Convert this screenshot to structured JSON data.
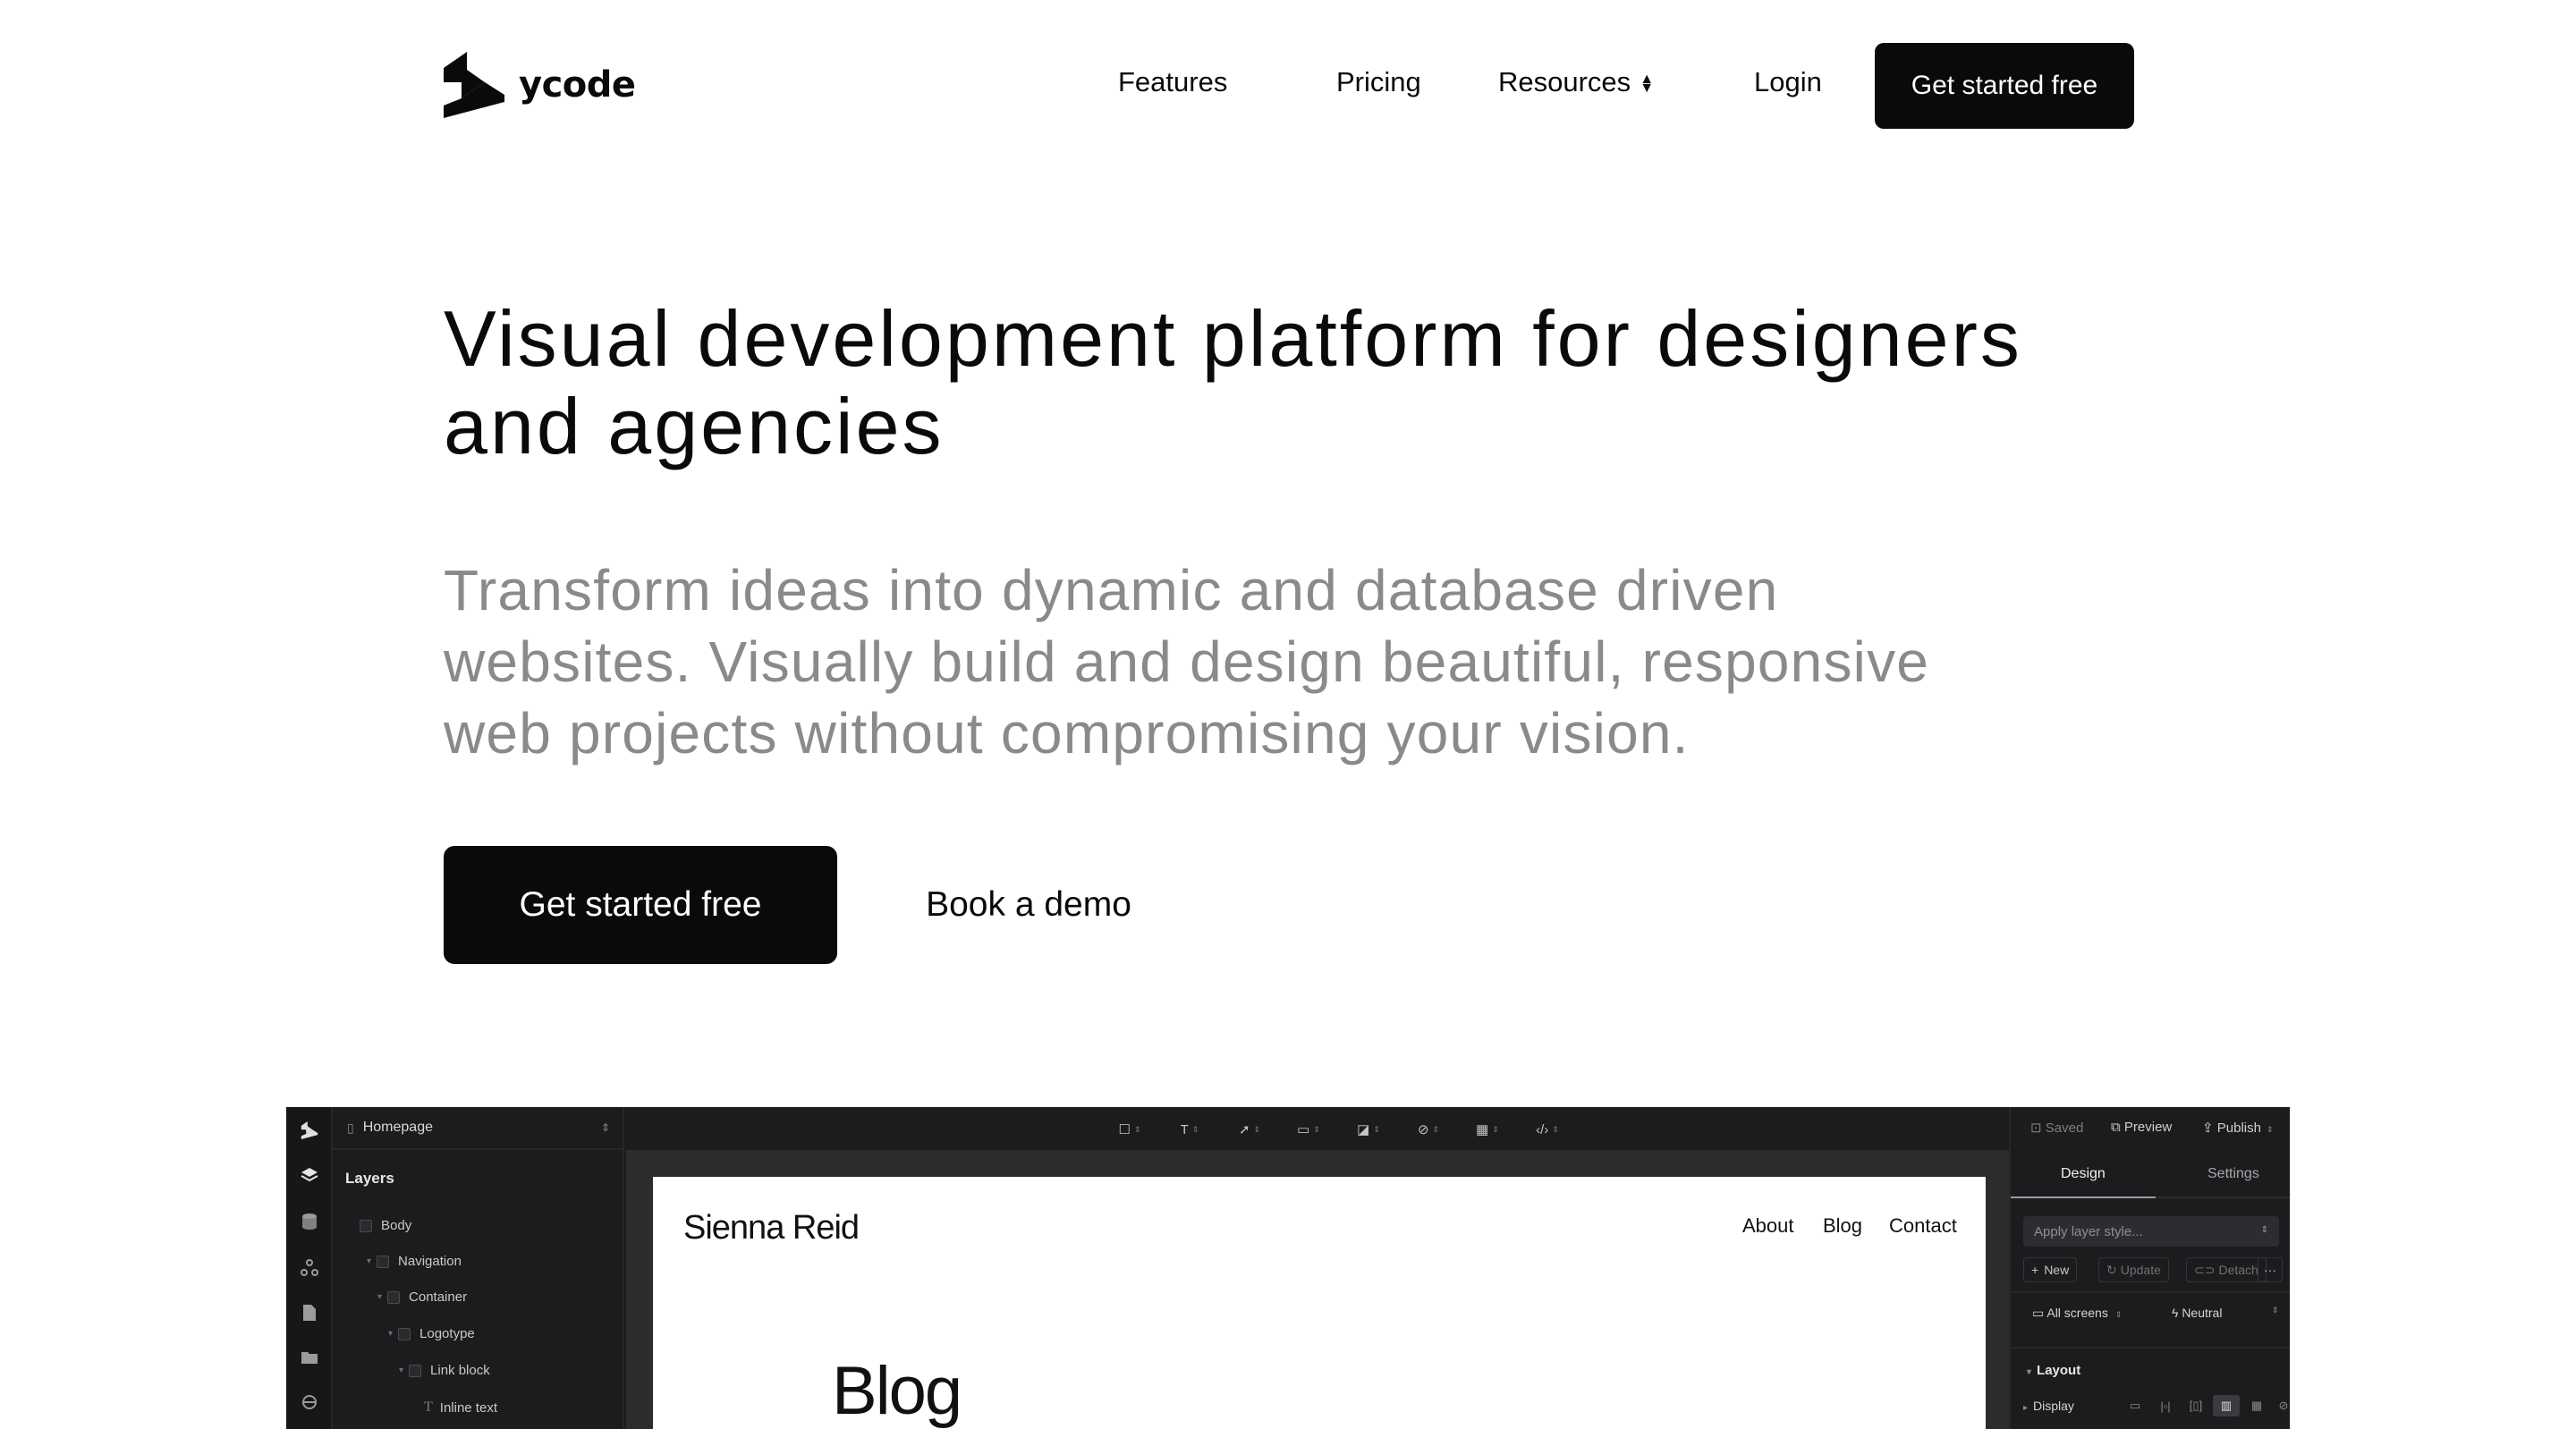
{
  "brand": {
    "name": "ycode"
  },
  "nav": {
    "features": "Features",
    "pricing": "Pricing",
    "resources": "Resources",
    "login": "Login",
    "cta": "Get started free"
  },
  "hero": {
    "title_line1": "Visual development platform for designers",
    "title_line2": "and agencies",
    "subtitle_line1": "Transform ideas into dynamic and database driven",
    "subtitle_line2": "websites. Visually build and design beautiful, responsive",
    "subtitle_line3": "web projects without compromising your vision.",
    "primary_cta": "Get started free",
    "secondary_cta": "Book a demo"
  },
  "app": {
    "page_select": "Homepage",
    "layers_title": "Layers",
    "layers": [
      "Body",
      "Navigation",
      "Container",
      "Logotype",
      "Link block",
      "Inline text"
    ],
    "status": {
      "saved": "Saved",
      "preview": "Preview",
      "publish": "Publish"
    },
    "tabs": {
      "design": "Design",
      "settings": "Settings"
    },
    "style_placeholder": "Apply layer style...",
    "buttons": {
      "new": "New",
      "update": "Update",
      "detach": "Detach",
      "more": "···"
    },
    "screens": {
      "all": "All screens",
      "state": "Neutral"
    },
    "layout_title": "Layout",
    "display_label": "Display",
    "canvas": {
      "site_name": "Sienna Reid",
      "links": [
        "About",
        "Blog",
        "Contact"
      ],
      "heading": "Blog"
    }
  },
  "colors": {
    "primary": "#0a0a0a",
    "muted_text": "#8a8a8a",
    "app_bg": "#1b1c1d"
  }
}
